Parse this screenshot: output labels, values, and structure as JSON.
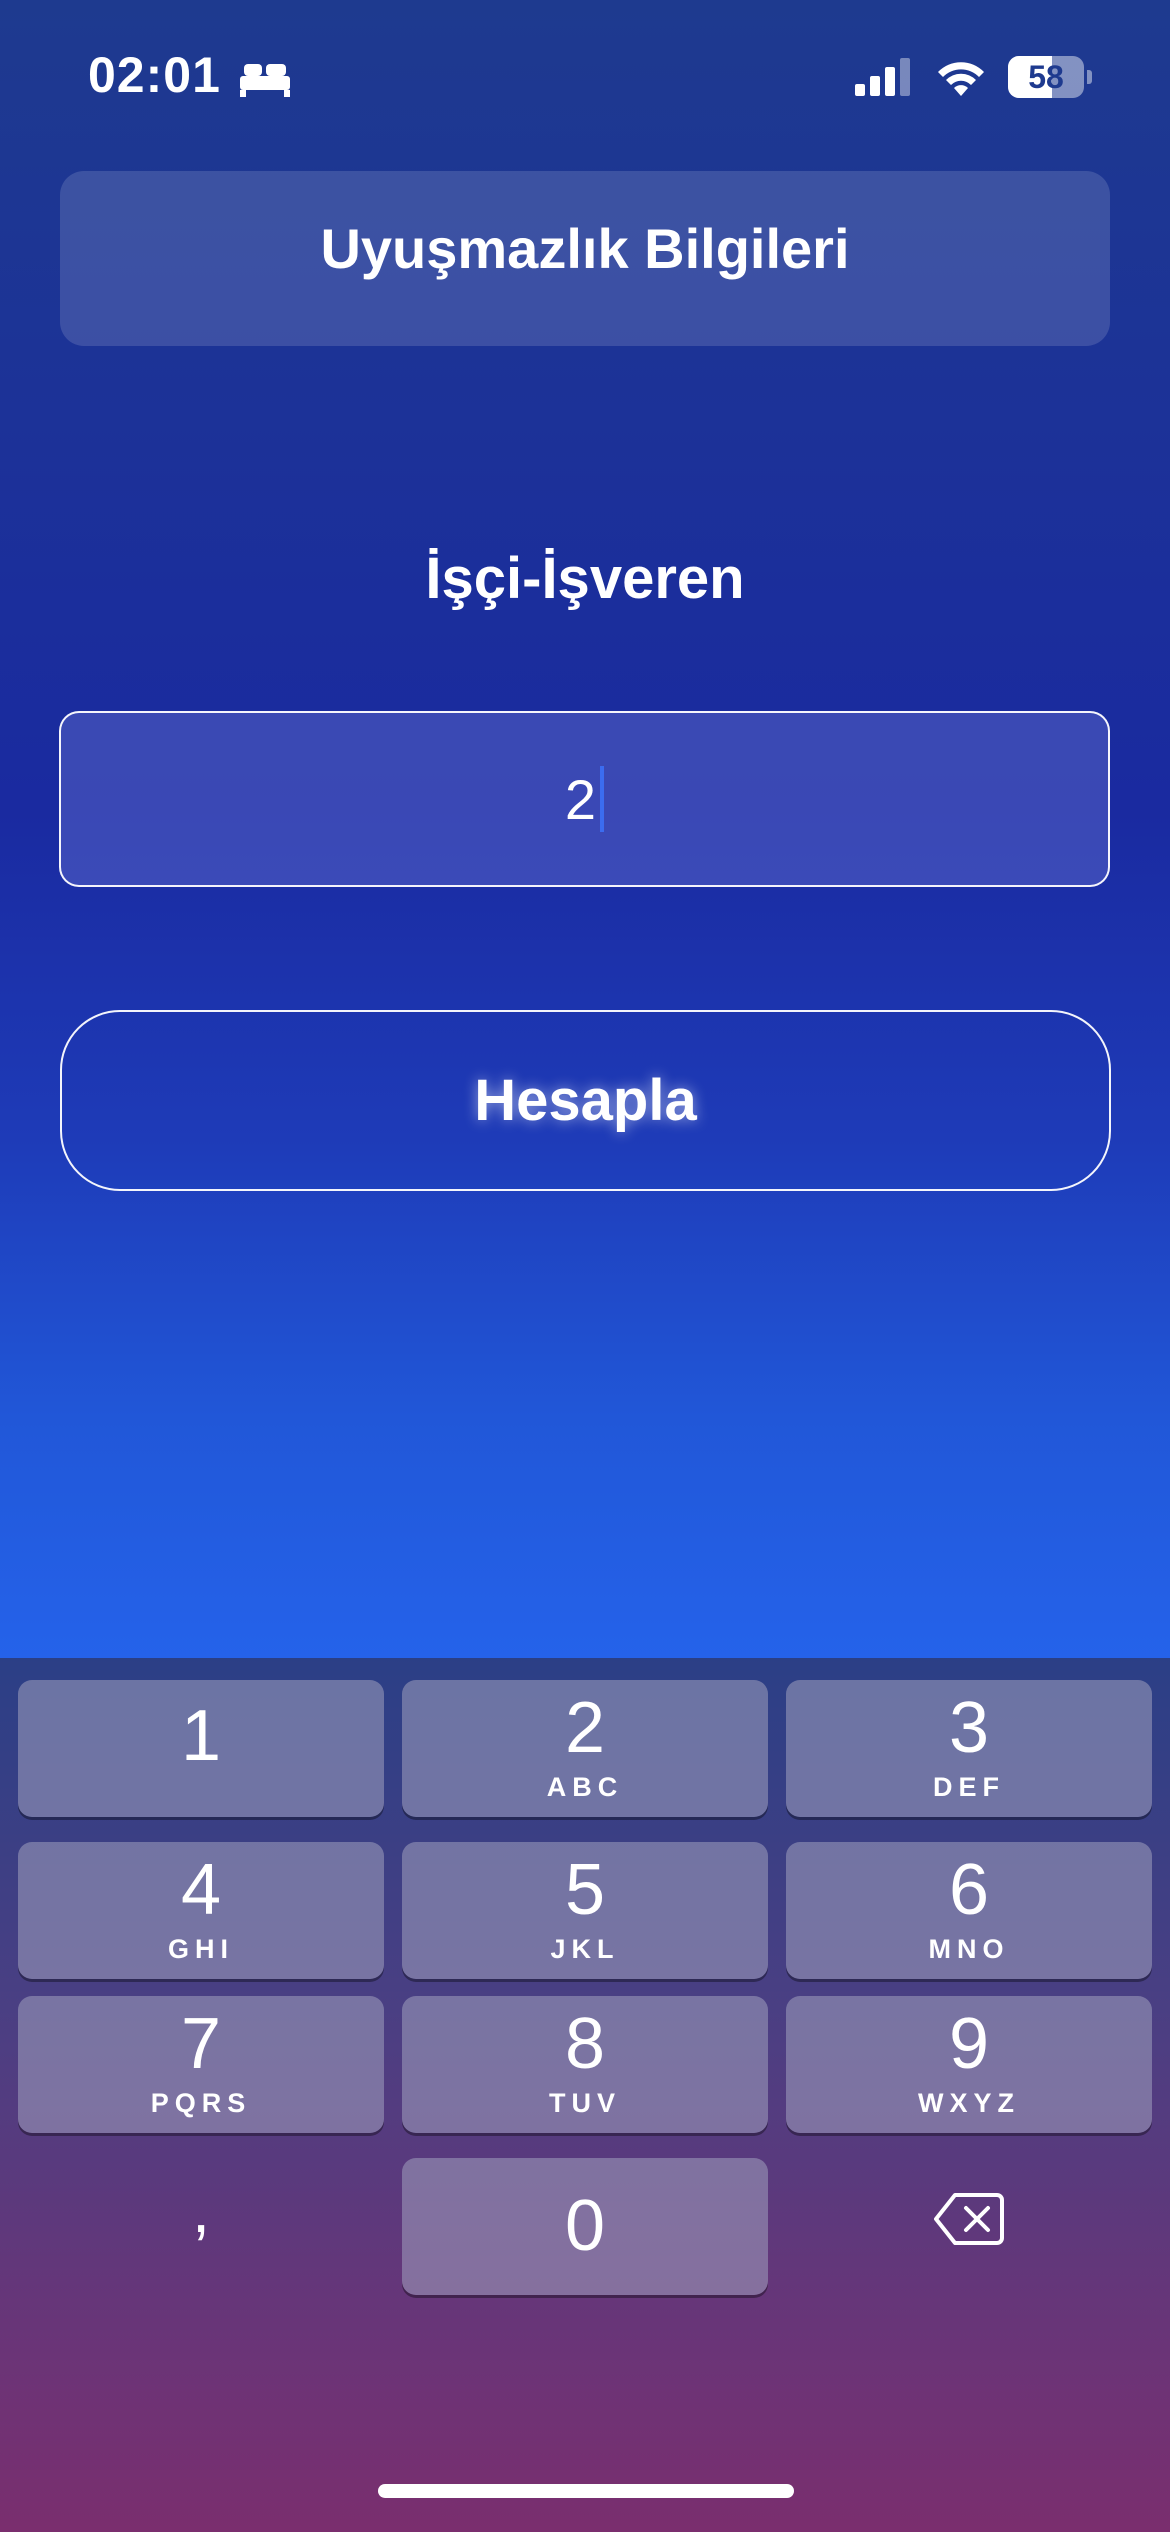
{
  "status_bar": {
    "time": "02:01",
    "battery_level": "58",
    "battery_fraction": 0.58,
    "icons": [
      "sleep-focus-icon",
      "cellular-signal-icon",
      "wifi-icon",
      "battery-icon"
    ]
  },
  "header": {
    "title": "Uyuşmazlık Bilgileri"
  },
  "form": {
    "section_label": "İşçi-İşveren",
    "input_value": "2",
    "calculate_label": "Hesapla"
  },
  "keyboard": {
    "keys": [
      {
        "num": "1",
        "letters": ""
      },
      {
        "num": "2",
        "letters": "ABC"
      },
      {
        "num": "3",
        "letters": "DEF"
      },
      {
        "num": "4",
        "letters": "GHI"
      },
      {
        "num": "5",
        "letters": "JKL"
      },
      {
        "num": "6",
        "letters": "MNO"
      },
      {
        "num": "7",
        "letters": "PQRS"
      },
      {
        "num": "8",
        "letters": "TUV"
      },
      {
        "num": "9",
        "letters": "WXYZ"
      }
    ],
    "comma": ",",
    "zero": "0",
    "backspace_icon": "backspace-icon"
  },
  "colors": {
    "background_top": "#1e3a8f",
    "background_bottom": "#2563eb",
    "caret": "#3b6cf0"
  }
}
